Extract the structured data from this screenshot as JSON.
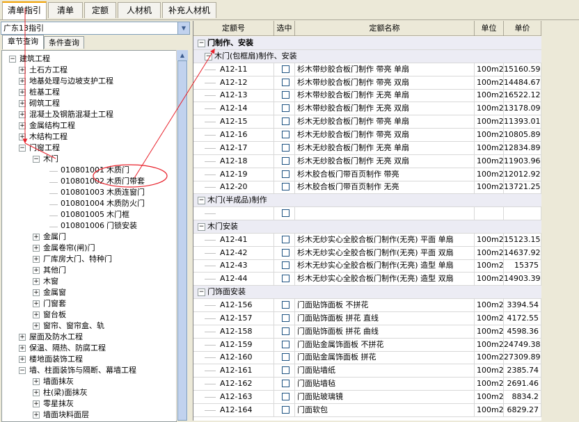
{
  "top_tabs": [
    "清单指引",
    "清单",
    "定额",
    "人材机",
    "补充人材机"
  ],
  "left_panel": {
    "combo_value": "广东13指引",
    "sub_tabs": [
      "章节查询",
      "条件查询"
    ],
    "tree": [
      {
        "label": "建筑工程",
        "level": 0,
        "box": "−"
      },
      {
        "label": "土石方工程",
        "level": 1,
        "box": "+"
      },
      {
        "label": "地基处理与边坡支护工程",
        "level": 1,
        "box": "+"
      },
      {
        "label": "桩基工程",
        "level": 1,
        "box": "+"
      },
      {
        "label": "砌筑工程",
        "level": 1,
        "box": "+"
      },
      {
        "label": "混凝土及钢筋混凝土工程",
        "level": 1,
        "box": "+"
      },
      {
        "label": "金属结构工程",
        "level": 1,
        "box": "+"
      },
      {
        "label": "木结构工程",
        "level": 1,
        "box": "+"
      },
      {
        "label": "门窗工程",
        "level": 1,
        "box": "−"
      },
      {
        "label": "木门",
        "level": 2,
        "box": "−"
      },
      {
        "code": "010801001",
        "label": "木质门",
        "level": 3
      },
      {
        "code": "010801002",
        "label": "木质门带套",
        "level": 3
      },
      {
        "code": "010801003",
        "label": "木质连窗门",
        "level": 3
      },
      {
        "code": "010801004",
        "label": "木质防火门",
        "level": 3
      },
      {
        "code": "010801005",
        "label": "木门框",
        "level": 3
      },
      {
        "code": "010801006",
        "label": "门锁安装",
        "level": 3
      },
      {
        "label": "金属门",
        "level": 2,
        "box": "+"
      },
      {
        "label": "金属卷帘(闸)门",
        "level": 2,
        "box": "+"
      },
      {
        "label": "厂库房大门、特种门",
        "level": 2,
        "box": "+"
      },
      {
        "label": "其他门",
        "level": 2,
        "box": "+"
      },
      {
        "label": "木窗",
        "level": 2,
        "box": "+"
      },
      {
        "label": "金属窗",
        "level": 2,
        "box": "+"
      },
      {
        "label": "门窗套",
        "level": 2,
        "box": "+"
      },
      {
        "label": "窗台板",
        "level": 2,
        "box": "+"
      },
      {
        "label": "窗帘、窗帘盒、轨",
        "level": 2,
        "box": "+"
      },
      {
        "label": "屋面及防水工程",
        "level": 1,
        "box": "+"
      },
      {
        "label": "保温、隔热、防腐工程",
        "level": 1,
        "box": "+"
      },
      {
        "label": "楼地面装饰工程",
        "level": 1,
        "box": "+"
      },
      {
        "label": "墙、柱面装饰与隔断、幕墙工程",
        "level": 1,
        "box": "−"
      },
      {
        "label": "墙面抹灰",
        "level": 2,
        "box": "+"
      },
      {
        "label": "柱(梁)面抹灰",
        "level": 2,
        "box": "+"
      },
      {
        "label": "零星抹灰",
        "level": 2,
        "box": "+"
      },
      {
        "label": "墙面块料面层",
        "level": 2,
        "box": "+"
      }
    ]
  },
  "grid": {
    "headers": [
      "定额号",
      "选中",
      "定额名称",
      "单位",
      "单价"
    ],
    "rows": [
      {
        "type": "group",
        "label": "门制作、安装",
        "level": 0,
        "bold": true
      },
      {
        "type": "group",
        "label": "木门(包框扇)制作、安装",
        "level": 1
      },
      {
        "type": "item",
        "code": "A12-11",
        "name": "杉木带纱胶合板门制作 带亮 单扇",
        "unit": "100m2",
        "price": "15160.59"
      },
      {
        "type": "item",
        "code": "A12-12",
        "name": "杉木带纱胶合板门制作 带亮 双扇",
        "unit": "100m2",
        "price": "14484.67"
      },
      {
        "type": "item",
        "code": "A12-13",
        "name": "杉木带纱胶合板门制作 无亮 单扇",
        "unit": "100m2",
        "price": "16522.12"
      },
      {
        "type": "item",
        "code": "A12-14",
        "name": "杉木带纱胶合板门制作 无亮 双扇",
        "unit": "100m2",
        "price": "13178.09"
      },
      {
        "type": "item",
        "code": "A12-15",
        "name": "杉木无纱胶合板门制作 带亮 单扇",
        "unit": "100m2",
        "price": "11393.01"
      },
      {
        "type": "item",
        "code": "A12-16",
        "name": "杉木无纱胶合板门制作 带亮 双扇",
        "unit": "100m2",
        "price": "10805.89"
      },
      {
        "type": "item",
        "code": "A12-17",
        "name": "杉木无纱胶合板门制作 无亮 单扇",
        "unit": "100m2",
        "price": "12834.89"
      },
      {
        "type": "item",
        "code": "A12-18",
        "name": "杉木无纱胶合板门制作 无亮 双扇",
        "unit": "100m2",
        "price": "11903.96"
      },
      {
        "type": "item",
        "code": "A12-19",
        "name": "杉木胶合板门带百页制作 带亮",
        "unit": "100m2",
        "price": "12012.92"
      },
      {
        "type": "item",
        "code": "A12-20",
        "name": "杉木胶合板门带百页制作 无亮",
        "unit": "100m2",
        "price": "13721.25"
      },
      {
        "type": "group",
        "label": "木门(半成品)制作",
        "level": 0
      },
      {
        "type": "item",
        "code": "",
        "name": "",
        "unit": "",
        "price": ""
      },
      {
        "type": "group",
        "label": "木门安装",
        "level": 0
      },
      {
        "type": "item",
        "code": "A12-41",
        "name": "杉木无纱实心全胶合板门制作(无亮) 平面 单扇",
        "unit": "100m2",
        "price": "15123.15"
      },
      {
        "type": "item",
        "code": "A12-42",
        "name": "杉木无纱实心全胶合板门制作(无亮) 平面 双扇",
        "unit": "100m2",
        "price": "14637.92"
      },
      {
        "type": "item",
        "code": "A12-43",
        "name": "杉木无纱实心全胶合板门制作(无亮) 造型 单扇",
        "unit": "100m2",
        "price": "15375"
      },
      {
        "type": "item",
        "code": "A12-44",
        "name": "杉木无纱实心全胶合板门制作(无亮) 造型 双扇",
        "unit": "100m2",
        "price": "14903.39"
      },
      {
        "type": "group",
        "label": "门饰面安装",
        "level": 0
      },
      {
        "type": "item",
        "code": "A12-156",
        "name": "门面贴饰面板 不拼花",
        "unit": "100m2",
        "price": "3394.54"
      },
      {
        "type": "item",
        "code": "A12-157",
        "name": "门面贴饰面板 拼花 直线",
        "unit": "100m2",
        "price": "4172.55"
      },
      {
        "type": "item",
        "code": "A12-158",
        "name": "门面贴饰面板 拼花 曲线",
        "unit": "100m2",
        "price": "4598.36"
      },
      {
        "type": "item",
        "code": "A12-159",
        "name": "门面贴金属饰面板 不拼花",
        "unit": "100m2",
        "price": "24749.38"
      },
      {
        "type": "item",
        "code": "A12-160",
        "name": "门面贴金属饰面板 拼花",
        "unit": "100m2",
        "price": "27309.89"
      },
      {
        "type": "item",
        "code": "A12-161",
        "name": "门面贴墙纸",
        "unit": "100m2",
        "price": "2385.74"
      },
      {
        "type": "item",
        "code": "A12-162",
        "name": "门面贴墙毡",
        "unit": "100m2",
        "price": "2691.46"
      },
      {
        "type": "item",
        "code": "A12-163",
        "name": "门面贴玻璃镜",
        "unit": "100m2",
        "price": "8834.2"
      },
      {
        "type": "item",
        "code": "A12-164",
        "name": "门面软包",
        "unit": "100m2",
        "price": "6829.27"
      }
    ]
  },
  "colors": {
    "annotation": "#e8202a",
    "group_row_bg": "#ececf4",
    "tab_accent": "#f0a000"
  }
}
